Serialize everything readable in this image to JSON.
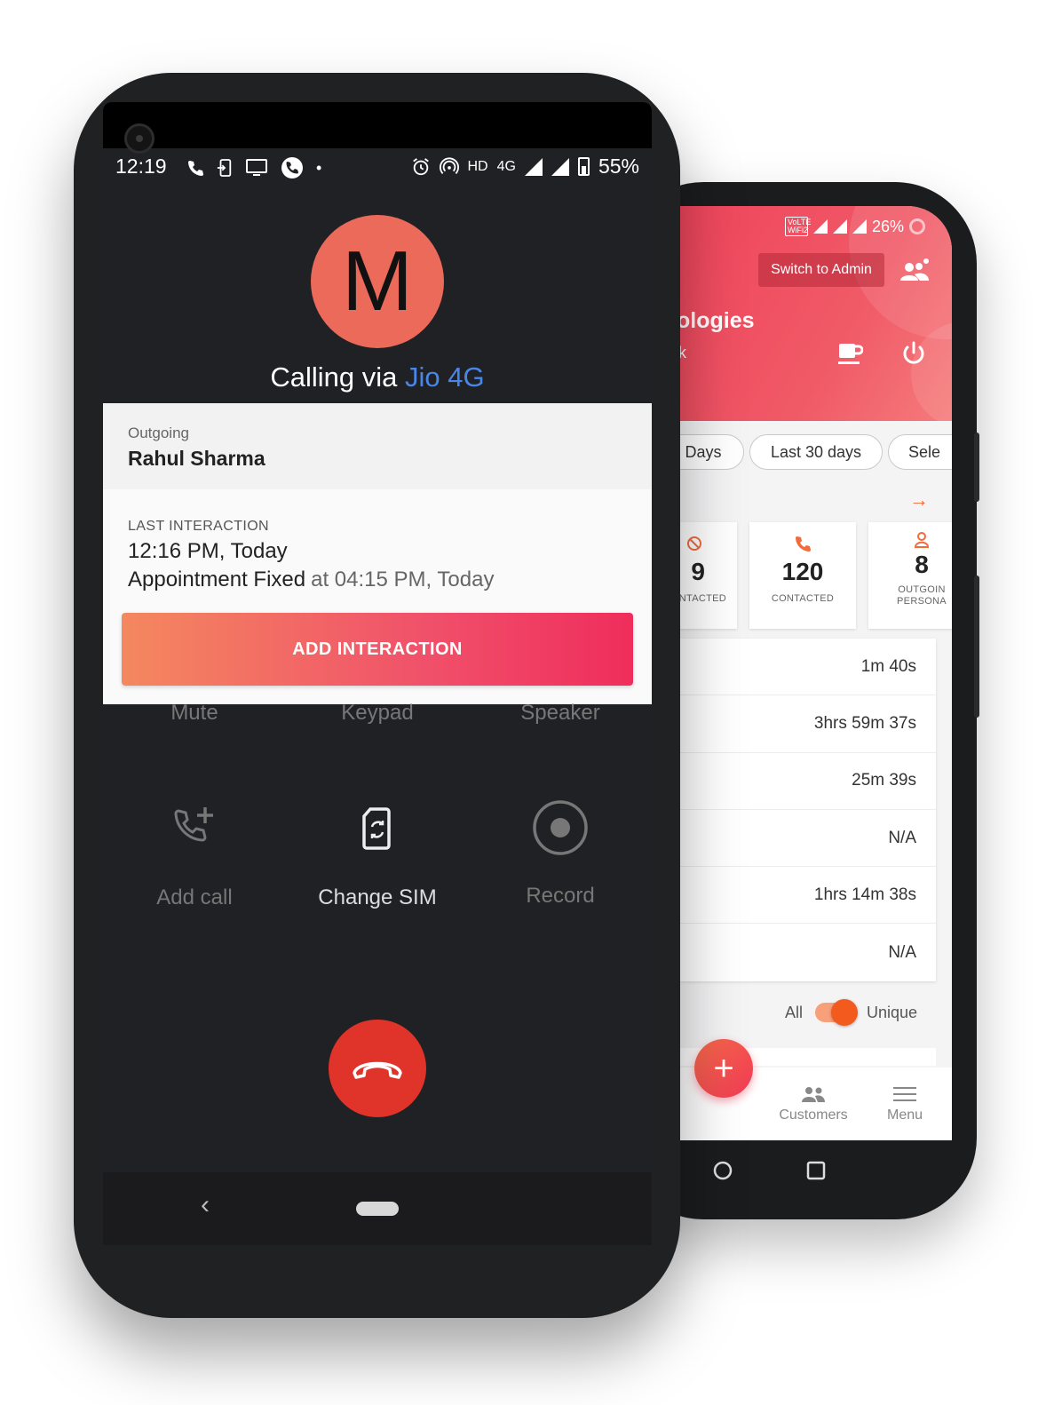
{
  "back_phone": {
    "status": {
      "wifi_label": "VoLTE WiFi2",
      "battery": "26%"
    },
    "header": {
      "switch_admin": "Switch to Admin",
      "company_partial": "ologies",
      "company_sub_partial": "k"
    },
    "filters": [
      "Days",
      "Last 30 days",
      "Sele"
    ],
    "stats": [
      {
        "value": "9",
        "label": "NTACTED"
      },
      {
        "value": "120",
        "label": "CONTACTED"
      },
      {
        "value": "8",
        "label_line1": "OUTGOIN",
        "label_line2": "PERSONA"
      }
    ],
    "durations": [
      "1m 40s",
      "3hrs 59m 37s",
      "25m 39s",
      "N/A",
      "1hrs 14m 38s",
      "N/A"
    ],
    "toggle": {
      "left": "All",
      "right": "Unique"
    },
    "fab_label": "+",
    "nav": [
      {
        "label": "Customers",
        "icon": "people-icon"
      },
      {
        "label": "Menu",
        "icon": "menu-icon"
      }
    ],
    "colors": {
      "accent": "#f0455c",
      "orange": "#f25a1e"
    }
  },
  "front_phone": {
    "status": {
      "time": "12:19",
      "network": "HD",
      "network2": "4G",
      "battery": "55%"
    },
    "avatar_letter": "M",
    "calling_prefix": "Calling via",
    "carrier": "Jio 4G",
    "outgoing_label": "Outgoing",
    "contact_name": "Rahul Sharma",
    "last_interaction": {
      "label": "LAST INTERACTION",
      "time": "12:16 PM, Today",
      "status": "Appointment Fixed",
      "status_detail": "at 04:15 PM, Today"
    },
    "add_button": "ADD INTERACTION",
    "controls_top": [
      "Mute",
      "Keypad",
      "Speaker"
    ],
    "controls": [
      {
        "label": "Add call",
        "icon": "add-call-icon"
      },
      {
        "label": "Change SIM",
        "icon": "change-sim-icon"
      },
      {
        "label": "Record",
        "icon": "record-icon"
      }
    ],
    "colors": {
      "avatar": "#eb6a5a",
      "carrier": "#4a86e8",
      "end_call": "#e0332a"
    }
  }
}
